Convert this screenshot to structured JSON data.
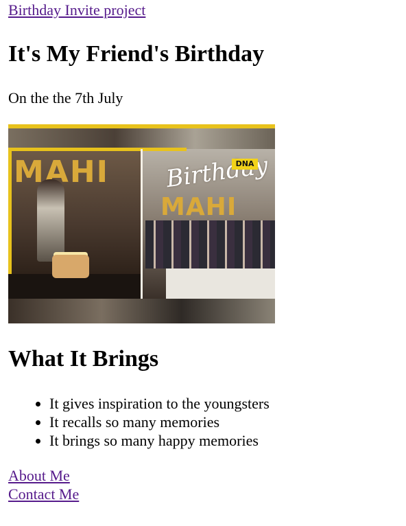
{
  "nav": {
    "top_link": "Birthday Invite project"
  },
  "header": {
    "title": "It's My Friend's Birthday",
    "date_text": "On the the 7th July"
  },
  "photo": {
    "left_banner_text": "MAHI",
    "right_banner_text": "MAHI",
    "cursive_text": "Birthday",
    "badge_text": "DNA",
    "accent_color": "#e8c21c"
  },
  "section": {
    "title": "What It Brings",
    "items": [
      "It gives inspiration to the youngsters",
      "It recalls so many memories",
      "It brings so many happy memories"
    ]
  },
  "footer": {
    "about": "About Me",
    "contact": "Contact Me"
  }
}
